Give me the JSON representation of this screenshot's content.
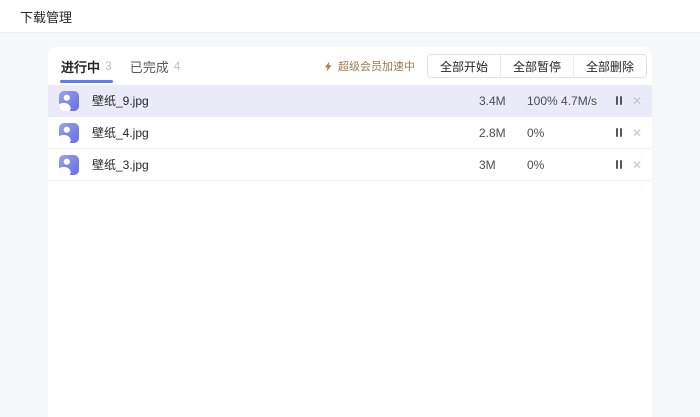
{
  "window": {
    "title": "下载管理"
  },
  "tabs": [
    {
      "label": "进行中",
      "count": "3",
      "active": true
    },
    {
      "label": "已完成",
      "count": "4",
      "active": false
    }
  ],
  "member_badge": {
    "icon": "lightning-icon",
    "label": "超级会员加速中"
  },
  "toolbar": {
    "start_all": "全部开始",
    "pause_all": "全部暂停",
    "delete_all": "全部删除"
  },
  "downloads": [
    {
      "name": "壁纸_9.jpg",
      "size": "3.4M",
      "progress": "100% 4.7M/s",
      "highlighted": true
    },
    {
      "name": "壁纸_4.jpg",
      "size": "2.8M",
      "progress": "0%",
      "highlighted": false
    },
    {
      "name": "壁纸_3.jpg",
      "size": "3M",
      "progress": "0%",
      "highlighted": false
    }
  ],
  "icons": {
    "file_type": "picture-icon",
    "member": "lightning-icon",
    "row_actions": [
      "pause-icon",
      "close-icon"
    ]
  },
  "colors": {
    "accent_blue": "#5b7cf9",
    "member_gold": "#9c7b4b",
    "highlight_row": "#eaeaf9",
    "icon_gradient_start": "#9ba1ee",
    "icon_gradient_end": "#666ee0",
    "page_background": "#f6f7f8"
  }
}
